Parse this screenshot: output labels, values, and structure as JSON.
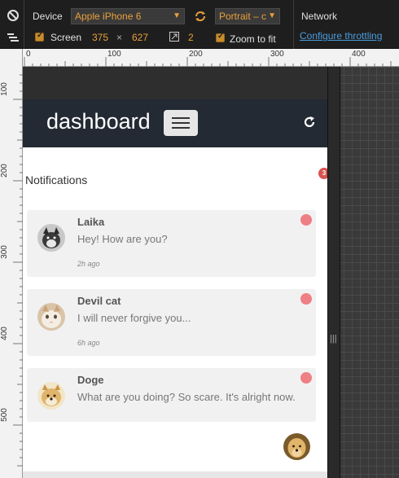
{
  "toolbar": {
    "device_label": "Device",
    "device_value": "Apple iPhone 6",
    "orientation_value": "Portrait – c",
    "screen_label": "Screen",
    "screen_width": "375",
    "times": "×",
    "screen_height": "627",
    "dpr_value": "2",
    "zoom_label": "Zoom to fit",
    "network_label": "Network",
    "throttle_link": "Configure throttling",
    "accent_color": "#e8a03a"
  },
  "rulers": {
    "h_ticks": [
      "0",
      "100",
      "200",
      "300",
      "400"
    ],
    "v_ticks": [
      "100",
      "200",
      "300",
      "400",
      "500"
    ]
  },
  "app": {
    "brand": "dashboard",
    "section_title": "Notifications",
    "badge_count": "3",
    "notifications": [
      {
        "name": "Laika",
        "message": "Hey! How are you?",
        "time": "2h ago",
        "avatar": "dog-avatar"
      },
      {
        "name": "Devil cat",
        "message": "I will never forgive you...",
        "time": "6h ago",
        "avatar": "cat-avatar"
      },
      {
        "name": "Doge",
        "message": "What are you doing? So scare. It's alright now.",
        "time": "",
        "avatar": "doge-avatar"
      }
    ]
  },
  "colors": {
    "navbar": "#232a33",
    "unread_dot": "#ee7f84",
    "card_bg": "#f1f1f1"
  }
}
